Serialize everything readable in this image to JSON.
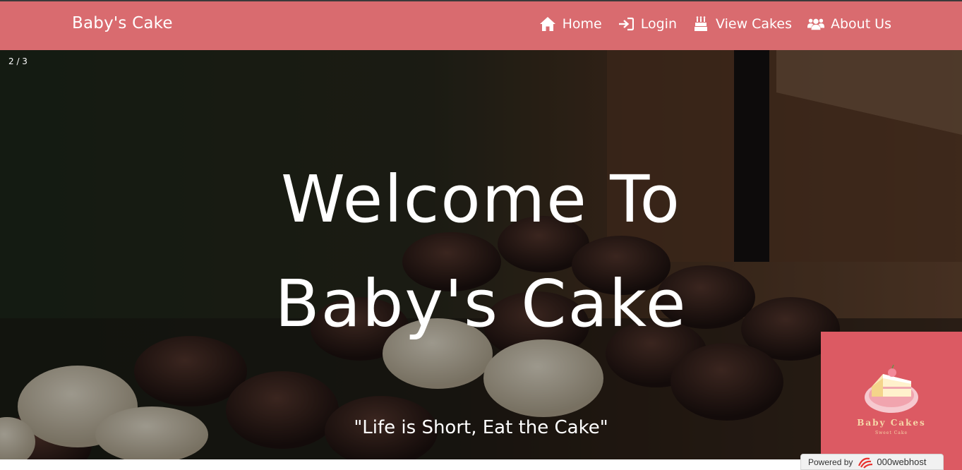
{
  "navbar": {
    "brand": "Baby's Cake",
    "items": [
      {
        "label": "Home",
        "icon": "home-icon"
      },
      {
        "label": "Login",
        "icon": "login-icon"
      },
      {
        "label": "View Cakes",
        "icon": "birthday-cake-icon"
      },
      {
        "label": "About Us",
        "icon": "users-icon"
      }
    ]
  },
  "hero": {
    "slide_counter": "2 / 3",
    "title_line1": "Welcome To",
    "title_line2": "Baby's Cake",
    "tagline": "\"Life is Short, Eat the Cake\""
  },
  "logo_widget": {
    "title": "Baby Cakes",
    "subtitle": "Sweet Cake"
  },
  "footer_badge": {
    "powered_by": "Powered by",
    "host": "000webhost"
  },
  "colors": {
    "navbar_bg": "#d96b6f",
    "logo_bg": "#dc5a63",
    "text_light": "#ffffff"
  }
}
